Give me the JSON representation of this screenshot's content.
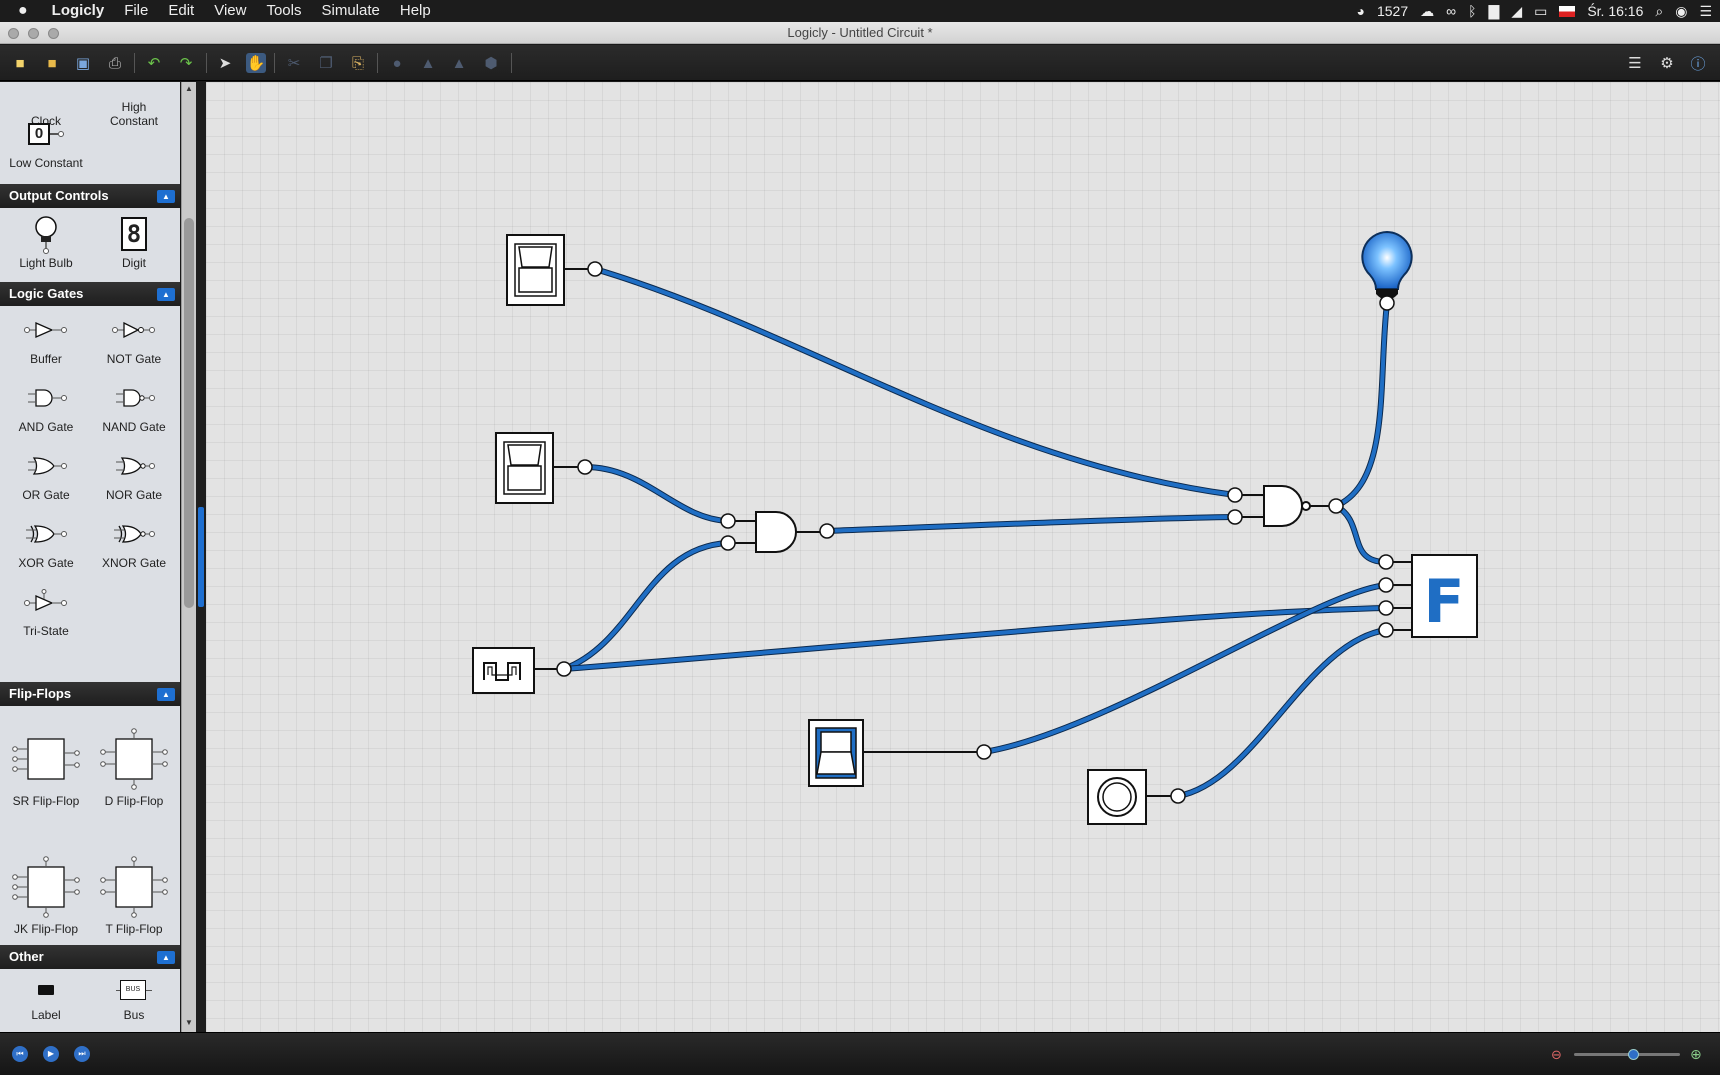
{
  "menubar": {
    "app": "Logicly",
    "items": [
      "File",
      "Edit",
      "View",
      "Tools",
      "Simulate",
      "Help"
    ],
    "status": {
      "counter": "1527",
      "clock": "Śr. 16:16"
    }
  },
  "window": {
    "title": "Logicly - Untitled Circuit *"
  },
  "sidebar": {
    "inputs_items": [
      {
        "label": "Clock"
      },
      {
        "label": "High\nConstant"
      },
      {
        "label": "Low Constant",
        "glyph": "0"
      }
    ],
    "output_controls": {
      "title": "Output Controls",
      "items": [
        {
          "label": "Light Bulb"
        },
        {
          "label": "Digit",
          "glyph": "8"
        }
      ]
    },
    "logic_gates": {
      "title": "Logic Gates",
      "items": [
        {
          "label": "Buffer"
        },
        {
          "label": "NOT Gate"
        },
        {
          "label": "AND Gate"
        },
        {
          "label": "NAND Gate"
        },
        {
          "label": "OR Gate"
        },
        {
          "label": "NOR Gate"
        },
        {
          "label": "XOR Gate"
        },
        {
          "label": "XNOR Gate"
        },
        {
          "label": "Tri-State"
        }
      ]
    },
    "flip_flops": {
      "title": "Flip-Flops",
      "items": [
        {
          "label": "SR Flip-Flop"
        },
        {
          "label": "D Flip-Flop"
        },
        {
          "label": "JK Flip-Flop"
        },
        {
          "label": "T Flip-Flop"
        }
      ]
    },
    "other": {
      "title": "Other",
      "items": [
        {
          "label": "Label"
        },
        {
          "label": "Bus",
          "glyph": "BUS"
        }
      ]
    }
  },
  "canvas": {
    "digit_display": "F",
    "wire_color": "#1f6ec4"
  },
  "colors": {
    "accent": "#1e6fd1",
    "wire": "#1f6ec4",
    "bulb_on": "#3a9af0"
  }
}
